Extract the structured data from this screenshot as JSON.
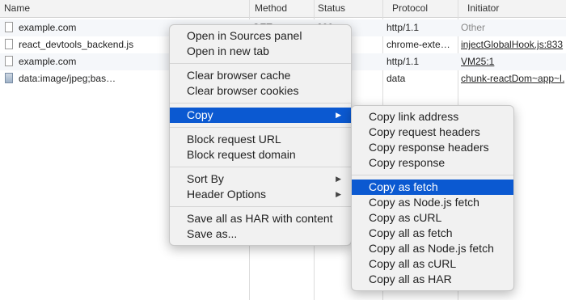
{
  "table": {
    "columns": [
      "Name",
      "Method",
      "Status",
      "Protocol",
      "Initiator"
    ],
    "rows": [
      {
        "name": "example.com",
        "method": "GET",
        "status": "200",
        "protocol": "http/1.1",
        "initiator": "Other",
        "icon": "document-icon"
      },
      {
        "name": "react_devtools_backend.js",
        "method": "",
        "status": "",
        "protocol": "chrome-exte…",
        "initiator": "injectGlobalHook.js:833",
        "icon": "document-icon"
      },
      {
        "name": "example.com",
        "method": "",
        "status": "",
        "protocol": "http/1.1",
        "initiator": "VM25:1",
        "icon": "document-icon"
      },
      {
        "name": "data:image/jpeg;bas…",
        "method": "",
        "status": "",
        "protocol": "data",
        "initiator": "chunk-reactDom~app~l…",
        "icon": "image-icon"
      }
    ]
  },
  "context_menu": {
    "items": [
      "Open in Sources panel",
      "Open in new tab",
      "Clear browser cache",
      "Clear browser cookies",
      "Copy",
      "Block request URL",
      "Block request domain",
      "Sort By",
      "Header Options",
      "Save all as HAR with content",
      "Save as..."
    ],
    "highlighted": "Copy"
  },
  "copy_submenu": {
    "items": [
      "Copy link address",
      "Copy request headers",
      "Copy response headers",
      "Copy response",
      "Copy as fetch",
      "Copy as Node.js fetch",
      "Copy as cURL",
      "Copy all as fetch",
      "Copy all as Node.js fetch",
      "Copy all as cURL",
      "Copy all as HAR"
    ],
    "highlighted": "Copy as fetch"
  },
  "colors": {
    "highlight": "#0b59d1",
    "header_bg": "#f3f3f3",
    "menu_bg": "#f1f1f1"
  }
}
